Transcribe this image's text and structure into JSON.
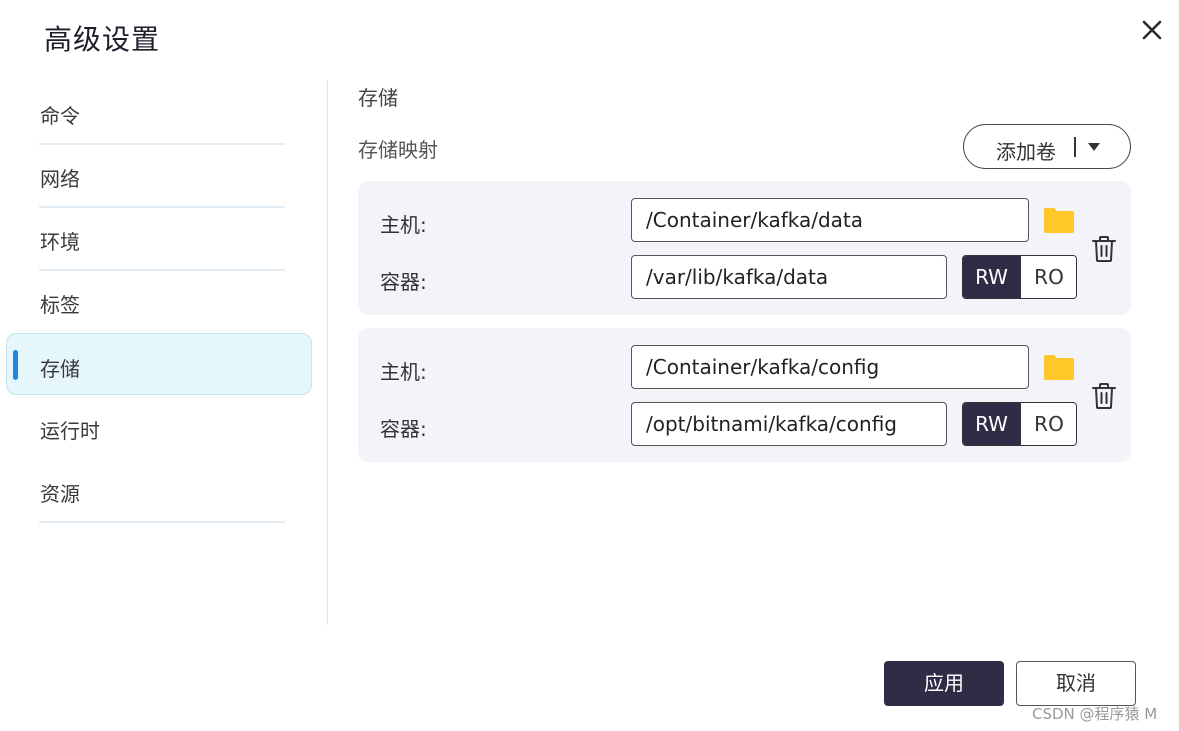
{
  "dialog": {
    "title": "高级设置",
    "close_icon": "close-icon"
  },
  "sidebar": {
    "items": [
      {
        "label": "命令",
        "active": false
      },
      {
        "label": "网络",
        "active": false
      },
      {
        "label": "环境",
        "active": false
      },
      {
        "label": "标签",
        "active": false
      },
      {
        "label": "存储",
        "active": true
      },
      {
        "label": "运行时",
        "active": false
      },
      {
        "label": "资源",
        "active": false
      }
    ],
    "active_color": "#1e88e5"
  },
  "main": {
    "section_title": "存储",
    "subsection_title": "存储映射",
    "add_volume_label": "添加卷",
    "mappings": [
      {
        "host_label": "主机:",
        "host_path": "/Container/kafka/data",
        "container_label": "容器:",
        "container_path": "/var/lib/kafka/data",
        "mode_options": [
          "RW",
          "RO"
        ],
        "selected_mode": "RW"
      },
      {
        "host_label": "主机:",
        "host_path": "/Container/kafka/config",
        "container_label": "容器:",
        "container_path": "/opt/bitnami/kafka/config",
        "mode_options": [
          "RW",
          "RO"
        ],
        "selected_mode": "RW"
      }
    ]
  },
  "footer": {
    "apply_label": "应用",
    "cancel_label": "取消"
  },
  "watermark": "CSDN @程序猿 M",
  "colors": {
    "primary": "#2f2d45",
    "folder": "#ffc727",
    "card_bg": "#f3f4f9",
    "active_item_bg": "#e6f6fd"
  }
}
